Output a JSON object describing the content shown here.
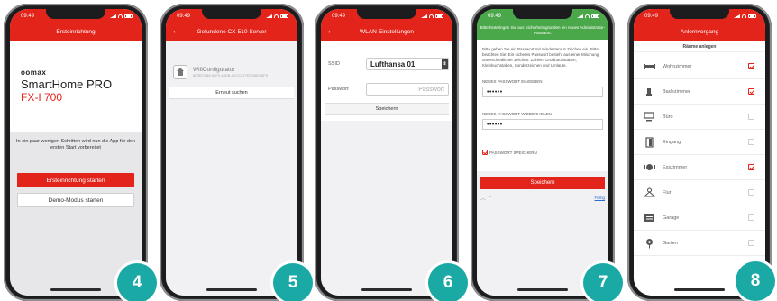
{
  "status_bar": {
    "time": "09:49"
  },
  "screens": {
    "s4": {
      "title": "Ersteinrichtung",
      "brand_small": "oomax",
      "brand_main": "SmartHome PRO",
      "brand_model": "FX-I 700",
      "intro_text": "In ein paar wenigen Schritten wird nun die App für den ersten Start vorbereitet",
      "start_button": "Ersteinrichtung starten",
      "demo_button": "Demo-Modus starten",
      "step": "4"
    },
    "s5": {
      "title": "Gefundene CX-510 Server",
      "server_name": "WifiConfigurator",
      "server_id": "8F2EC9B8-98F0-48DB-AECC-27E0336E68FE",
      "search_again": "Erneut suchen",
      "step": "5"
    },
    "s6": {
      "title": "WLAN-Einstellungen",
      "ssid_label": "SSID",
      "ssid_value": "Lufthansa 01",
      "password_label": "Passwort",
      "password_placeholder": "Passwort",
      "save_button": "Speichern",
      "step": "6"
    },
    "s7": {
      "banner": "Bitte hinterlegen Sie aus Sicherheitsgründen ein neues Administrator-Passwort.",
      "info_text": "Bitte geben Sie ein Passwort mit mindestens 6 Zeichen ein. Bitte beachten Sie: Ein sicheres Passwort besteht aus einer Mischung unterschiedlicher Zeichen: Zahlen, Großbuchstaben, Kleinbuchstaben, Sonderzeichen und Umlaute.",
      "new_pw_label": "NEUES PASSWORT EINGEBEN",
      "new_pw_value": "••••••",
      "repeat_pw_label": "NEUES PASSWORT WIEDERHOLEN",
      "repeat_pw_value": "••••••",
      "save_pw_checkbox": "PASSWORT SPEICHERN",
      "save_button": "Speichern",
      "done": "Fertig",
      "step": "7"
    },
    "s8": {
      "title": "Anlernvorgang",
      "subtitle": "Räume anlegen",
      "rooms": [
        {
          "label": "Wohnzimmer",
          "checked": true,
          "icon": "sofa-icon"
        },
        {
          "label": "Badezimmer",
          "checked": true,
          "icon": "bath-icon"
        },
        {
          "label": "Büro",
          "checked": false,
          "icon": "desk-icon"
        },
        {
          "label": "Eingang",
          "checked": false,
          "icon": "door-icon"
        },
        {
          "label": "Esszimmer",
          "checked": true,
          "icon": "dining-icon"
        },
        {
          "label": "Flur",
          "checked": false,
          "icon": "hallway-icon"
        },
        {
          "label": "Garage",
          "checked": false,
          "icon": "garage-icon"
        },
        {
          "label": "Garten",
          "checked": false,
          "icon": "garden-icon"
        }
      ],
      "step": "8"
    }
  },
  "colors": {
    "accent": "#e3241b",
    "banner_green": "#4aa84a",
    "badge": "#1aa9a5"
  }
}
